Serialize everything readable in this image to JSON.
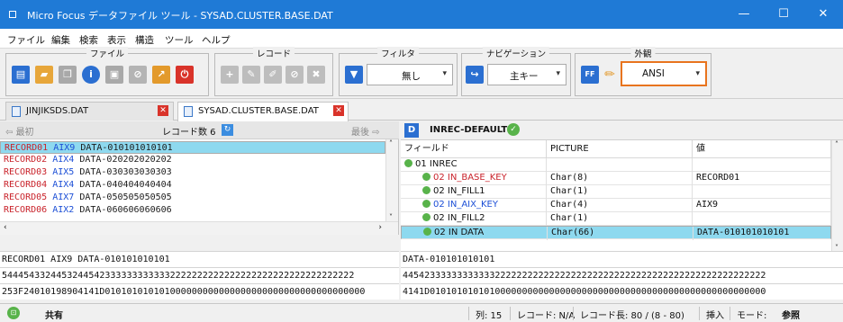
{
  "window": {
    "title": "Micro Focus データファイル ツール - SYSAD.CLUSTER.BASE.DAT",
    "minimize": "—",
    "maximize": "☐",
    "close": "✕"
  },
  "menu": [
    "ファイル",
    "編集",
    "検索",
    "表示",
    "構造",
    "ツール",
    "ヘルプ"
  ],
  "toolbar": {
    "groups": {
      "file": "ファイル",
      "record": "レコード",
      "filter": "フィルタ",
      "navigation": "ナビゲーション",
      "appearance": "外観"
    },
    "filter_value": "無し",
    "navigation_value": "主キー",
    "encoding_value": "ANSI",
    "colors": {
      "highlight": "#e8741e",
      "accent": "#1f7ad6"
    }
  },
  "tabs": [
    {
      "label": "JINJIKSDS.DAT",
      "close": "✕"
    },
    {
      "label": "SYSAD.CLUSTER.BASE.DAT",
      "close": "✕"
    }
  ],
  "left": {
    "first": "最初",
    "record_count": "レコード数 6",
    "last": "最後",
    "records": [
      {
        "key": "RECORD01",
        "aix": "AIX9",
        "data": "DATA-010101010101"
      },
      {
        "key": "RECORD02",
        "aix": "AIX4",
        "data": "DATA-020202020202"
      },
      {
        "key": "RECORD03",
        "aix": "AIX5",
        "data": "DATA-030303030303"
      },
      {
        "key": "RECORD04",
        "aix": "AIX4",
        "data": "DATA-040404040404"
      },
      {
        "key": "RECORD05",
        "aix": "AIX7",
        "data": "DATA-050505050505"
      },
      {
        "key": "RECORD06",
        "aix": "AIX2",
        "data": "DATA-060606060606"
      }
    ],
    "text_line": "RECORD01 AIX9 DATA-010101010101",
    "hex_line1": "54445433244532445423333333333332222222222222222222222222222222222",
    "hex_line2": "253F24010198904141D010101010101000000000000000000000000000000000000"
  },
  "right": {
    "structure": "INREC-DEFAULT",
    "columns": [
      "フィールド",
      "PICTURE",
      "値"
    ],
    "rows": [
      {
        "field": "01 INREC",
        "picture": "",
        "value": ""
      },
      {
        "field": "02 IN_BASE_KEY",
        "picture": "Char(8)",
        "value": "RECORD01"
      },
      {
        "field": "02 IN_FILL1",
        "picture": "Char(1)",
        "value": ""
      },
      {
        "field": "02 IN_AIX_KEY",
        "picture": "Char(4)",
        "value": "AIX9"
      },
      {
        "field": "02 IN_FILL2",
        "picture": "Char(1)",
        "value": ""
      },
      {
        "field": "02 IN DATA",
        "picture": "Char(66)",
        "value": "DATA-010101010101"
      }
    ],
    "text_line": "DATA-010101010101",
    "hex_line1": "4454233333333333322222222222222222222222222222222222222222222222222",
    "hex_line2": "4141D01010101010100000000000000000000000000000000000000000000000000"
  },
  "status": {
    "mode": "共有",
    "column": "列: 15",
    "record_no": "レコード: N/A",
    "record_len": "レコード長: 80 / (8 - 80)",
    "insert": "挿入",
    "mode_label": "モード:",
    "mode_value": "参照"
  }
}
